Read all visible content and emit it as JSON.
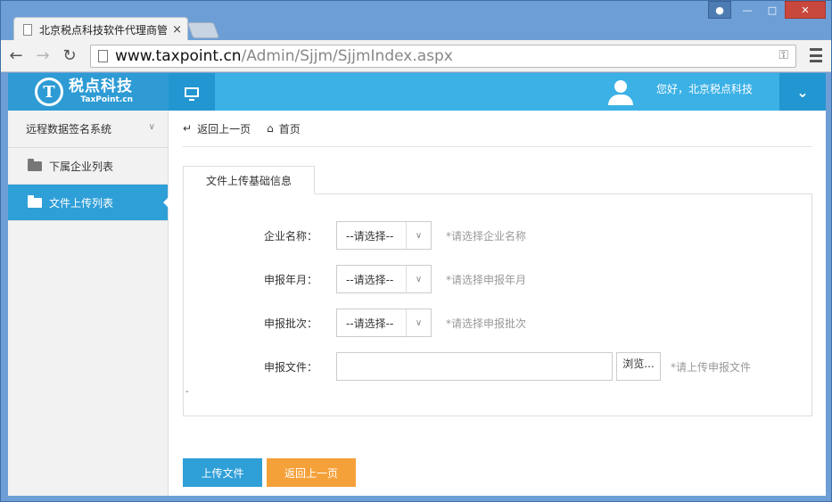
{
  "browser": {
    "tab_title": "北京税点科技软件代理商管",
    "tab_close": "×",
    "url_host": "www.taxpoint.cn",
    "url_path": "/Admin/Sjjm/SjjmIndex.aspx"
  },
  "header": {
    "logo_cn": "税点科技",
    "logo_en": "TaxPoint.cn",
    "greeting": "您好，北京税点科技"
  },
  "sidebar": {
    "group_label": "远程数据签名系统",
    "items": [
      {
        "label": "下属企业列表",
        "active": false
      },
      {
        "label": "文件上传列表",
        "active": true
      }
    ]
  },
  "breadcrumb": {
    "back_label": "返回上一页",
    "home_label": "首页"
  },
  "panel": {
    "tab_label": "文件上传基础信息"
  },
  "form": {
    "company": {
      "label": "企业名称：",
      "selected": "--请选择--",
      "hint": "*请选择企业名称"
    },
    "month": {
      "label": "申报年月：",
      "selected": "--请选择--",
      "hint": "*请选择申报年月"
    },
    "batch": {
      "label": "申报批次：",
      "selected": "--请选择--",
      "hint": "*请选择申报批次"
    },
    "file": {
      "label": "申报文件：",
      "browse_label": "浏览...",
      "hint": "*请上传申报文件"
    },
    "dash": "-"
  },
  "actions": {
    "upload_label": "上传文件",
    "back_label": "返回上一页"
  },
  "colors": {
    "header_blue": "#3bb1e6",
    "active_blue": "#2f9fd8",
    "orange": "#f5a13a"
  }
}
